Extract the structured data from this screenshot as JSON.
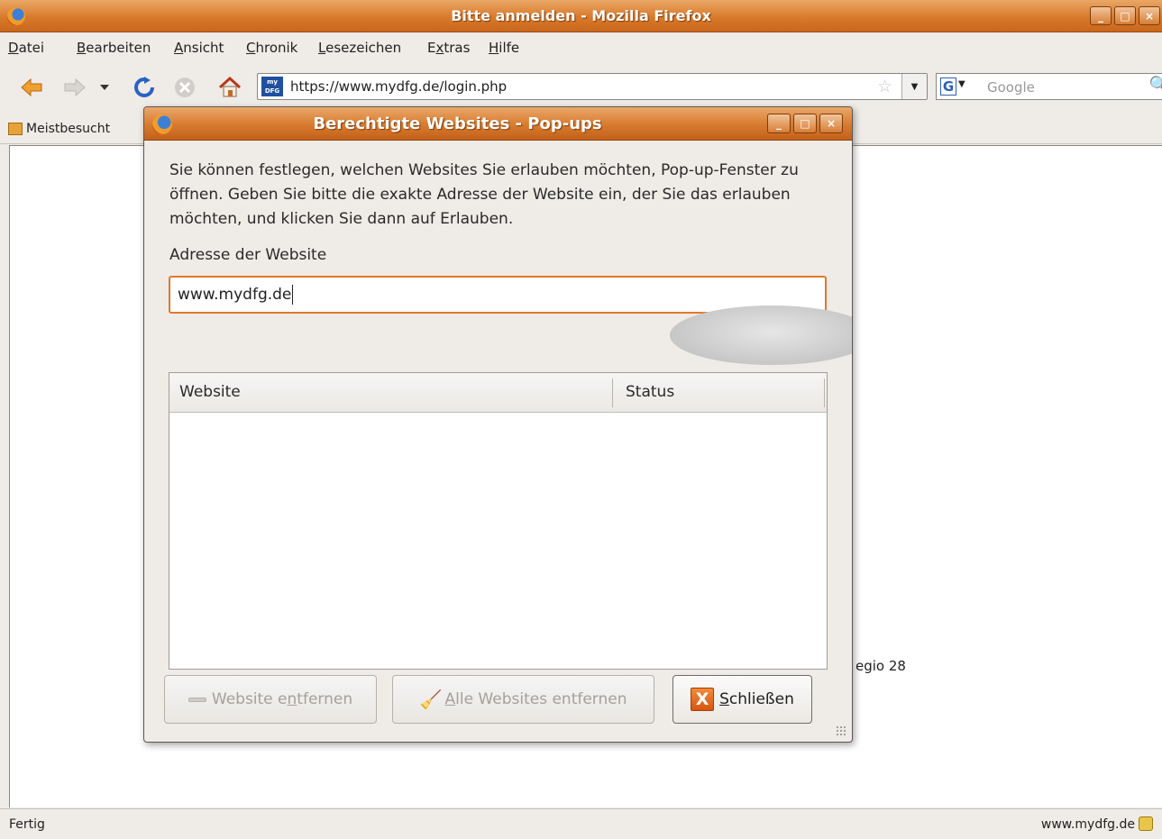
{
  "window": {
    "title": "Bitte anmelden - Mozilla Firefox",
    "controls": [
      "minimize",
      "maximize",
      "close"
    ]
  },
  "menubar": {
    "items": [
      {
        "label": "Datei",
        "accesskey": "D"
      },
      {
        "label": "Bearbeiten",
        "accesskey": "B"
      },
      {
        "label": "Ansicht",
        "accesskey": "A"
      },
      {
        "label": "Chronik",
        "accesskey": "C"
      },
      {
        "label": "Lesezeichen",
        "accesskey": "L"
      },
      {
        "label": "Extras",
        "accesskey": "x"
      },
      {
        "label": "Hilfe",
        "accesskey": "H"
      }
    ]
  },
  "navbar": {
    "url": "https://www.mydfg.de/login.php",
    "site_icon_text": "my DFG",
    "search_placeholder": "Google",
    "search_engine_letter": "G"
  },
  "bookmarks": {
    "item_label": "Meistbesucht"
  },
  "content": {
    "behind_text": "egio 28"
  },
  "statusbar": {
    "status": "Fertig",
    "domain": "www.mydfg.de"
  },
  "dialog": {
    "title": "Berechtigte Websites - Pop-ups",
    "description": "Sie können festlegen, welchen Websites Sie erlauben möchten, Pop-up-Fenster zu öffnen. Geben Sie bitte die exakte Adresse der Website ein, der Sie das erlauben möchten, und klicken Sie dann auf Erlauben.",
    "address_label": "Adresse der Website",
    "address_value": "www.mydfg.de",
    "table": {
      "columns": [
        "Website",
        "Status"
      ],
      "rows": []
    },
    "buttons": {
      "remove_site": {
        "pre": "Website e",
        "key": "n",
        "post": "tfernen"
      },
      "remove_all": {
        "pre": "",
        "key": "A",
        "post": "lle Websites entfernen"
      },
      "close": {
        "pre": "",
        "key": "S",
        "post": "chließen"
      }
    }
  },
  "colors": {
    "titlebar_orange": "#d97a2b",
    "focus_orange": "#e07a2a",
    "window_bg": "#efebe7"
  }
}
